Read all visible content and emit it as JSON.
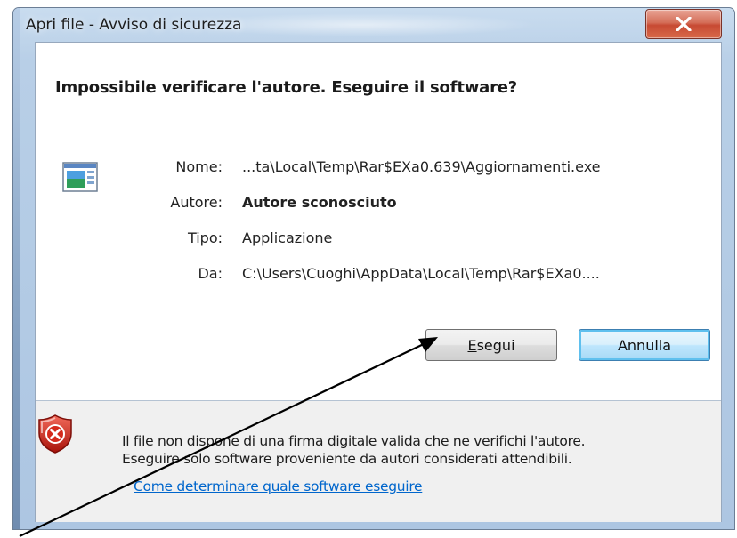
{
  "window": {
    "title": "Apri file - Avviso di sicurezza",
    "close_label": "X"
  },
  "dialog": {
    "headline": "Impossibile verificare l'autore. Eseguire il software?",
    "icon": "application-window-icon",
    "fields": [
      {
        "label": "Nome:",
        "value": "...ta\\Local\\Temp\\Rar$EXa0.639\\Aggiornamenti.exe",
        "bold": false
      },
      {
        "label": "Autore:",
        "value": "Autore sconosciuto",
        "bold": true
      },
      {
        "label": "Tipo:",
        "value": "Applicazione",
        "bold": false
      },
      {
        "label": "Da:",
        "value": "C:\\Users\\Cuoghi\\AppData\\Local\\Temp\\Rar$EXa0....",
        "bold": false
      }
    ],
    "buttons": {
      "run_label_mnemonic": "E",
      "run_label_rest": "segui",
      "cancel_label": "Annulla"
    }
  },
  "footer": {
    "icon": "shield-error-icon",
    "line1": "Il file non dispone di una firma digitale valida che ne verifichi l'autore.",
    "line2": "Eseguire solo software proveniente da autori considerati attendibili.",
    "link": "Come determinare quale software eseguire"
  },
  "colors": {
    "link": "#0066cc",
    "close_button": "#c74a33",
    "default_button_border": "#3c7fb1",
    "arrow": "#000000"
  }
}
